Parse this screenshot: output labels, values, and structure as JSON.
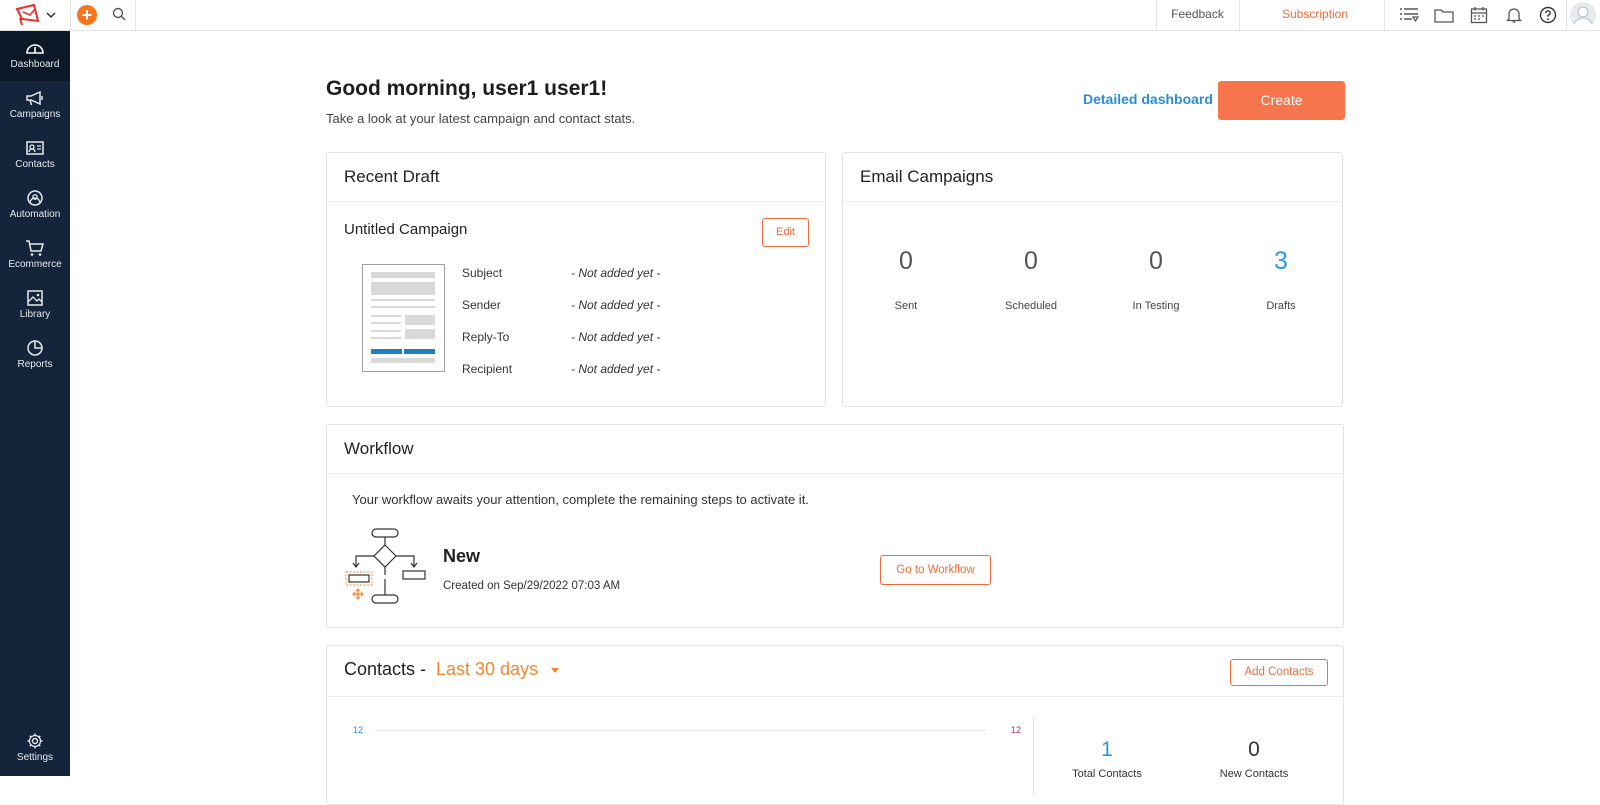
{
  "topbar": {
    "feedback": "Feedback",
    "subscription": "Subscription",
    "icons": [
      "list-filter-icon",
      "folder-icon",
      "calendar-icon",
      "bell-icon",
      "help-icon"
    ]
  },
  "sidebar": {
    "items": [
      {
        "label": "Dashboard",
        "icon": "dashboard-icon",
        "active": true
      },
      {
        "label": "Campaigns",
        "icon": "megaphone-icon"
      },
      {
        "label": "Contacts",
        "icon": "contact-card-icon"
      },
      {
        "label": "Automation",
        "icon": "automation-icon"
      },
      {
        "label": "Ecommerce",
        "icon": "cart-icon"
      },
      {
        "label": "Library",
        "icon": "image-icon"
      },
      {
        "label": "Reports",
        "icon": "pie-chart-icon"
      }
    ],
    "settings": "Settings"
  },
  "header": {
    "greeting": "Good morning, user1 user1!",
    "subtitle": "Take a look at your latest campaign and contact stats.",
    "detailed_dashboard": "Detailed dashboard",
    "create": "Create"
  },
  "recent_draft": {
    "title": "Recent Draft",
    "campaign_name": "Untitled Campaign",
    "edit": "Edit",
    "rows": [
      {
        "label": "Subject",
        "value": "- Not added yet -"
      },
      {
        "label": "Sender",
        "value": "- Not added yet -"
      },
      {
        "label": "Reply-To",
        "value": "- Not added yet -"
      },
      {
        "label": "Recipient",
        "value": "- Not added yet -"
      }
    ]
  },
  "email_campaigns": {
    "title": "Email Campaigns",
    "stats": [
      {
        "value": "0",
        "label": "Sent"
      },
      {
        "value": "0",
        "label": "Scheduled"
      },
      {
        "value": "0",
        "label": "In Testing"
      },
      {
        "value": "3",
        "label": "Drafts",
        "highlight": true
      }
    ]
  },
  "workflow": {
    "title": "Workflow",
    "message": "Your workflow awaits your attention, complete the remaining steps to activate it.",
    "name": "New",
    "created": "Created on Sep/29/2022 07:03 AM",
    "go_to": "Go to Workflow"
  },
  "contacts": {
    "title": "Contacts -",
    "period": "Last 30 days",
    "add": "Add Contacts",
    "axis_left": "12",
    "axis_right": "12",
    "total_value": "1",
    "total_label": "Total Contacts",
    "new_value": "0",
    "new_label": "New Contacts"
  },
  "colors": {
    "accent": "#f26b3a",
    "create_button": "#f7754d",
    "sidebar": "#14243a",
    "link_blue": "#2a8cd6"
  }
}
